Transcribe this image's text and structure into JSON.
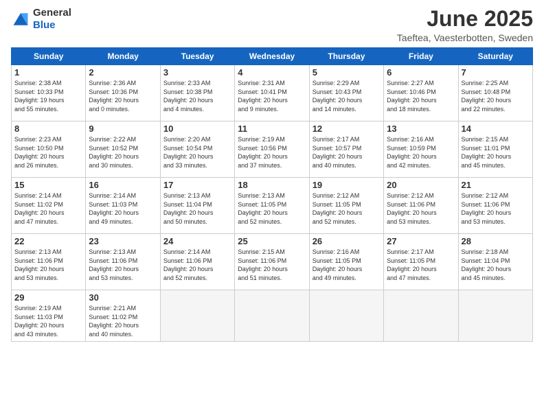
{
  "logo": {
    "general": "General",
    "blue": "Blue"
  },
  "header": {
    "month": "June 2025",
    "location": "Taeftea, Vaesterbotten, Sweden"
  },
  "days_of_week": [
    "Sunday",
    "Monday",
    "Tuesday",
    "Wednesday",
    "Thursday",
    "Friday",
    "Saturday"
  ],
  "weeks": [
    [
      {
        "day": "1",
        "info": "Sunrise: 2:38 AM\nSunset: 10:33 PM\nDaylight: 19 hours\nand 55 minutes."
      },
      {
        "day": "2",
        "info": "Sunrise: 2:36 AM\nSunset: 10:36 PM\nDaylight: 20 hours\nand 0 minutes."
      },
      {
        "day": "3",
        "info": "Sunrise: 2:33 AM\nSunset: 10:38 PM\nDaylight: 20 hours\nand 4 minutes."
      },
      {
        "day": "4",
        "info": "Sunrise: 2:31 AM\nSunset: 10:41 PM\nDaylight: 20 hours\nand 9 minutes."
      },
      {
        "day": "5",
        "info": "Sunrise: 2:29 AM\nSunset: 10:43 PM\nDaylight: 20 hours\nand 14 minutes."
      },
      {
        "day": "6",
        "info": "Sunrise: 2:27 AM\nSunset: 10:46 PM\nDaylight: 20 hours\nand 18 minutes."
      },
      {
        "day": "7",
        "info": "Sunrise: 2:25 AM\nSunset: 10:48 PM\nDaylight: 20 hours\nand 22 minutes."
      }
    ],
    [
      {
        "day": "8",
        "info": "Sunrise: 2:23 AM\nSunset: 10:50 PM\nDaylight: 20 hours\nand 26 minutes."
      },
      {
        "day": "9",
        "info": "Sunrise: 2:22 AM\nSunset: 10:52 PM\nDaylight: 20 hours\nand 30 minutes."
      },
      {
        "day": "10",
        "info": "Sunrise: 2:20 AM\nSunset: 10:54 PM\nDaylight: 20 hours\nand 33 minutes."
      },
      {
        "day": "11",
        "info": "Sunrise: 2:19 AM\nSunset: 10:56 PM\nDaylight: 20 hours\nand 37 minutes."
      },
      {
        "day": "12",
        "info": "Sunrise: 2:17 AM\nSunset: 10:57 PM\nDaylight: 20 hours\nand 40 minutes."
      },
      {
        "day": "13",
        "info": "Sunrise: 2:16 AM\nSunset: 10:59 PM\nDaylight: 20 hours\nand 42 minutes."
      },
      {
        "day": "14",
        "info": "Sunrise: 2:15 AM\nSunset: 11:01 PM\nDaylight: 20 hours\nand 45 minutes."
      }
    ],
    [
      {
        "day": "15",
        "info": "Sunrise: 2:14 AM\nSunset: 11:02 PM\nDaylight: 20 hours\nand 47 minutes."
      },
      {
        "day": "16",
        "info": "Sunrise: 2:14 AM\nSunset: 11:03 PM\nDaylight: 20 hours\nand 49 minutes."
      },
      {
        "day": "17",
        "info": "Sunrise: 2:13 AM\nSunset: 11:04 PM\nDaylight: 20 hours\nand 50 minutes."
      },
      {
        "day": "18",
        "info": "Sunrise: 2:13 AM\nSunset: 11:05 PM\nDaylight: 20 hours\nand 52 minutes."
      },
      {
        "day": "19",
        "info": "Sunrise: 2:12 AM\nSunset: 11:05 PM\nDaylight: 20 hours\nand 52 minutes."
      },
      {
        "day": "20",
        "info": "Sunrise: 2:12 AM\nSunset: 11:06 PM\nDaylight: 20 hours\nand 53 minutes."
      },
      {
        "day": "21",
        "info": "Sunrise: 2:12 AM\nSunset: 11:06 PM\nDaylight: 20 hours\nand 53 minutes."
      }
    ],
    [
      {
        "day": "22",
        "info": "Sunrise: 2:13 AM\nSunset: 11:06 PM\nDaylight: 20 hours\nand 53 minutes."
      },
      {
        "day": "23",
        "info": "Sunrise: 2:13 AM\nSunset: 11:06 PM\nDaylight: 20 hours\nand 53 minutes."
      },
      {
        "day": "24",
        "info": "Sunrise: 2:14 AM\nSunset: 11:06 PM\nDaylight: 20 hours\nand 52 minutes."
      },
      {
        "day": "25",
        "info": "Sunrise: 2:15 AM\nSunset: 11:06 PM\nDaylight: 20 hours\nand 51 minutes."
      },
      {
        "day": "26",
        "info": "Sunrise: 2:16 AM\nSunset: 11:05 PM\nDaylight: 20 hours\nand 49 minutes."
      },
      {
        "day": "27",
        "info": "Sunrise: 2:17 AM\nSunset: 11:05 PM\nDaylight: 20 hours\nand 47 minutes."
      },
      {
        "day": "28",
        "info": "Sunrise: 2:18 AM\nSunset: 11:04 PM\nDaylight: 20 hours\nand 45 minutes."
      }
    ],
    [
      {
        "day": "29",
        "info": "Sunrise: 2:19 AM\nSunset: 11:03 PM\nDaylight: 20 hours\nand 43 minutes."
      },
      {
        "day": "30",
        "info": "Sunrise: 2:21 AM\nSunset: 11:02 PM\nDaylight: 20 hours\nand 40 minutes."
      },
      {
        "day": "",
        "info": ""
      },
      {
        "day": "",
        "info": ""
      },
      {
        "day": "",
        "info": ""
      },
      {
        "day": "",
        "info": ""
      },
      {
        "day": "",
        "info": ""
      }
    ]
  ]
}
